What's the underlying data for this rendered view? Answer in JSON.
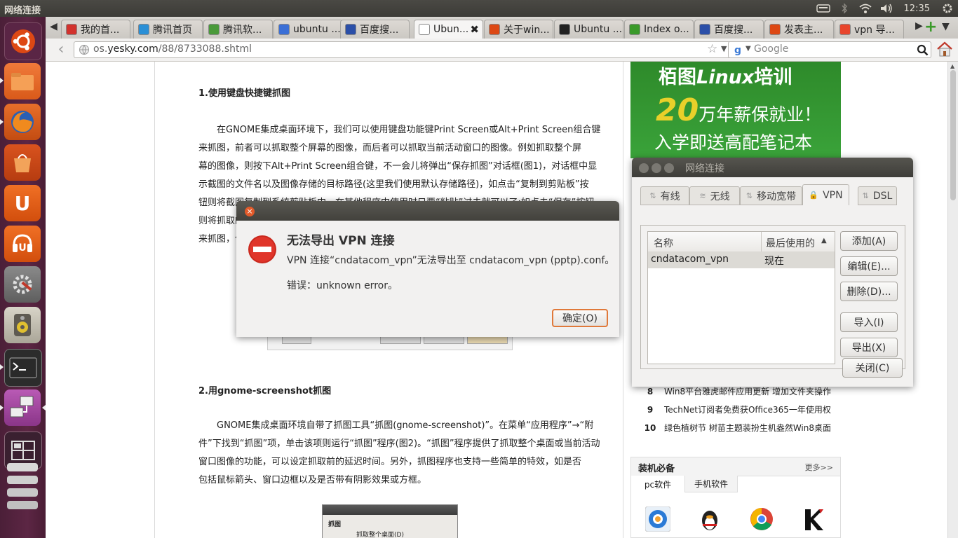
{
  "top_panel": {
    "title": "网络连接",
    "clock": "12:35"
  },
  "tabs": [
    {
      "label": "我的首...",
      "color": "#d2322d"
    },
    {
      "label": "腾讯首页",
      "color": "#2a8fd6"
    },
    {
      "label": "腾讯软...",
      "color": "#4a9a3a"
    },
    {
      "label": "ubuntu ...",
      "color": "#3b6fd6"
    },
    {
      "label": "百度搜...",
      "color": "#2b4fa8"
    },
    {
      "label": "Ubun...",
      "color": "#ffffff"
    },
    {
      "label": "关于win...",
      "color": "#dd4814"
    },
    {
      "label": "Ubuntu ...",
      "color": "#222222"
    },
    {
      "label": "Index o...",
      "color": "#3a9a2a"
    },
    {
      "label": "百度搜...",
      "color": "#2b4fa8"
    },
    {
      "label": "发表主...",
      "color": "#dd4814"
    },
    {
      "label": "vpn 导...",
      "color": "#e8452c"
    }
  ],
  "nav": {
    "url_prefix": "os.",
    "url_domain": "yesky.com",
    "url_path": "/88/8733088.shtml",
    "search_placeholder": "Google"
  },
  "article": {
    "h1": "1.使用键盘快捷键抓图",
    "p1_lines": [
      "在GNOME集成桌面环境下，我们可以使用键盘功能键Print Screen或Alt+Print Screen组合键",
      "来抓图，前者可以抓取整个屏幕的图像，而后者可以抓取当前活动窗口的图像。例如抓取整个屏",
      "幕的图像，则按下Alt+Print Screen组合键，不一会儿将弹出“保存抓图”对话框(图1)，对话框中显",
      "示截图的文件名以及图像存储的目标路径(这里我们使用默认存储路径)，如点击“复制到剪贴板”按",
      "钮则将截图复制到系统剪贴板中，在其他程序中使用时只要“粘贴”过去就可以了;如点击“保存”按钮",
      "则将抓取的屏",
      "来抓图，优点"
    ],
    "h2": "2.用gnome-screenshot抓图",
    "p2_lines": [
      "GNOME集成桌面环境自带了抓图工具“抓图(gnome-screenshot)”。在菜单“应用程序”→“附",
      "件”下找到“抓图”项，单击该项则运行“抓图”程序(图2)。“抓图”程序提供了抓取整个桌面或当前活动",
      "窗口图像的功能，可以设定抓取前的延迟时间。另外，抓图程序也支持一些简单的特效，如是否",
      "包括鼠标箭头、窗口边框以及是否带有阴影效果或方框。"
    ],
    "shot_title": "抓图",
    "shot_option": "抓取整个桌面(D)"
  },
  "ad": {
    "line1": "栢图",
    "line1b": "Linux",
    "line1c": "培训",
    "line2_num": "20",
    "line2": "万年薪保就业！",
    "line3": "入学即送高配笔记本"
  },
  "rank": [
    {
      "n": "8",
      "text": "Win8平台雅虎邮件应用更新 增加文件夹操作"
    },
    {
      "n": "9",
      "text": "TechNet订阅者免费获Office365一年使用权"
    },
    {
      "n": "10",
      "text": "绿色植树节 树苗主题装扮生机盎然Win8桌面"
    }
  ],
  "must": {
    "title": "装机必备",
    "more": "更多>>",
    "tab1": "pc软件",
    "tab2": "手机软件"
  },
  "netwin": {
    "title": "网络连接",
    "tabs": [
      "有线",
      "无线",
      "移动宽带",
      "VPN",
      "DSL"
    ],
    "col_name": "名称",
    "col_last": "最后使用的",
    "row_name": "cndatacom_vpn",
    "row_last": "现在",
    "buttons": [
      "添加(A)",
      "编辑(E)...",
      "删除(D)...",
      "导入(I)",
      "导出(X)"
    ],
    "close": "关闭(C)"
  },
  "dialog": {
    "heading": "无法导出 VPN 连接",
    "message": "VPN 连接“cndatacom_vpn”无法导出至 cndatacom_vpn (pptp).conf。",
    "error": "错误：unknown error。",
    "ok": "确定(O)"
  }
}
